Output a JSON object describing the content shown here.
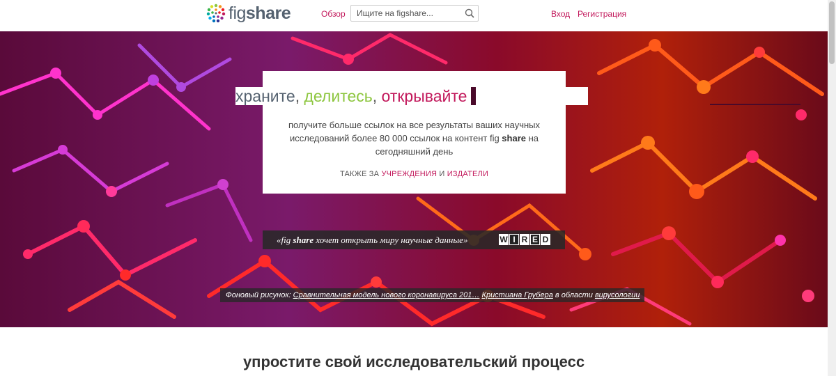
{
  "header": {
    "logo": {
      "fig": "fig",
      "share": "share"
    },
    "nav": {
      "browse": "Обзор",
      "login": "Вход",
      "register": "Регистрация"
    },
    "search": {
      "placeholder": "Ищите на figshare...",
      "value": ""
    }
  },
  "hero": {
    "tagline": {
      "store": "храните",
      "comma1": ", ",
      "share": "делитесь",
      "comma2": ", ",
      "discover": "открывайте"
    },
    "description": {
      "part1": "получите больше ссылок на все результаты ваших научных исследований более 80 000 ссылок на контент fig ",
      "bold": "share",
      "part2": " на сегодняшний день"
    },
    "also": {
      "prefix": "ТАКЖЕ ЗА ",
      "institutions": "УЧРЕЖДЕНИЯ",
      "and": " И ",
      "publishers": "ИЗДАТЕЛИ"
    },
    "quote": {
      "open": "«fig ",
      "bold": "share",
      "rest": " хочет открыть миру научные данные»",
      "wired": [
        "W",
        "I",
        "R",
        "E",
        "D"
      ]
    },
    "credit": {
      "prefix": "Фоновый рисунок: ",
      "title": "Сравнительная модель нового коронавируса 201…",
      "author": "Кристиана Грубера",
      "field_prefix": " в области ",
      "field": "вирусологии"
    }
  },
  "main": {
    "section_title": "упростите свой исследовательский процесс"
  },
  "colors": {
    "accent": "#c2185b",
    "green": "#8dc63f",
    "slate": "#556270"
  }
}
